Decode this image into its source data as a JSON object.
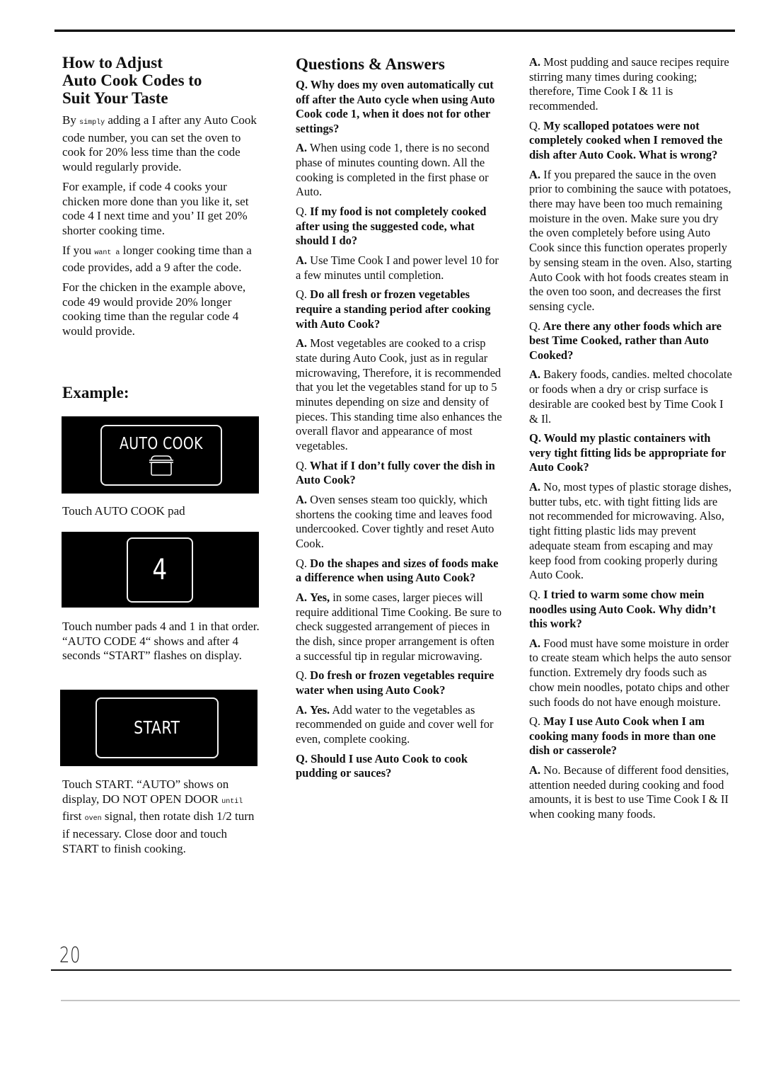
{
  "page_number": "20",
  "left": {
    "title_lines": [
      "How to Adjust",
      "Auto Cook Codes to",
      "Suit Your Taste"
    ],
    "paragraphs": [
      {
        "pre": "By",
        "mono": "simply",
        "post": "adding a I after any Auto Cook code number, you can set the oven to cook for 20% less time than the code would regularly provide."
      },
      {
        "text": "For example, if code 4 cooks your chicken more done than you like it, set code 4 I next time and you’ II get 20% shorter cooking time."
      },
      {
        "pre": "If you",
        "mono": "want a",
        "post": "longer cooking time than a code provides, add a 9 after the code."
      },
      {
        "text": "For the chicken in the example above, code 49 would provide 20% longer cooking time than the regular code 4 would provide."
      }
    ],
    "example_title": "Example:",
    "steps": [
      {
        "pad_label": "AUTO COOK",
        "pad_icon": "pot-icon",
        "caption": "Touch AUTO COOK pad"
      },
      {
        "pad_label": "4",
        "caption": "Touch number pads 4 and 1 in that order. “AUTO CODE 4“ shows and after 4 seconds “START” flashes on display."
      },
      {
        "pad_label": "START",
        "caption_parts": {
          "a": "Touch START. “AUTO” shows on display, DO NOT OPEN DOOR",
          "mono1": "until",
          "b": "first",
          "mono2": "oven",
          "c": "signal, then rotate dish 1/2 turn if necessary. Close door and touch START to finish cooking."
        }
      }
    ]
  },
  "qa": {
    "title": "Questions & Answers",
    "items": [
      {
        "q": "Why does my oven automatically cut off after the Auto cycle when using Auto Cook code 1, when it does not for other settings?",
        "q_prefix_bold": true,
        "a_lead": "",
        "a": "When using code 1, there is no second phase of minutes counting down. All the cooking is completed in the first phase or Auto."
      },
      {
        "q": "If my food is not completely cooked after using the suggested code, what should I do?",
        "q_prefix_bold": false,
        "a_lead": "",
        "a": "Use Time Cook I and power level 10 for a few minutes until completion."
      },
      {
        "q": "Do all fresh or frozen vegetables require a standing period after cooking with Auto Cook?",
        "q_prefix_bold": false,
        "a_lead": "",
        "a": "Most vegetables are cooked to a crisp state during Auto Cook, just as in regular microwaving, Therefore, it is recommended that you let the vegetables stand for up to 5 minutes depending on size and density of pieces. This standing time also enhances the overall flavor and appearance of most vegetables."
      },
      {
        "q": "What if I don’t fully cover the dish in Auto Cook?",
        "q_prefix_bold": false,
        "a_lead": "",
        "a": "Oven senses steam too quickly, which shortens the cooking time and leaves food undercooked. Cover tightly and reset Auto Cook."
      },
      {
        "q": "Do the shapes and sizes of foods make a difference when using Auto Cook?",
        "q_prefix_bold": false,
        "a_lead": "Yes,",
        "a": "in some cases, larger pieces will require additional Time Cooking. Be sure to check suggested arrangement of pieces in the dish, since proper arrangement is often a successful tip in regular microwaving."
      },
      {
        "q": "Do fresh or frozen vegetables require water when using Auto Cook?",
        "q_prefix_bold": false,
        "a_lead": "Yes.",
        "a": "Add water to the vegetables as recommended on guide and cover well for even, complete cooking."
      },
      {
        "q": "Should I use Auto Cook to cook pudding or sauces?",
        "q_prefix_bold": true,
        "a_lead": "",
        "a": "Most pudding and sauce recipes require stirring many times during cooking; therefore, Time Cook I & 11 is recommended."
      },
      {
        "q": "My scalloped potatoes were not completely cooked when I removed the dish after Auto Cook. What is wrong?",
        "q_prefix_bold": false,
        "a_lead": "",
        "a": "If you prepared the sauce in the oven prior to combining the sauce with potatoes, there may have been too much remaining moisture in the oven. Make sure you dry the oven completely before using Auto Cook since this function operates properly by sensing steam in the oven. Also, starting Auto Cook with hot foods creates steam in the oven too soon, and decreases the first sensing cycle."
      },
      {
        "q": "Are there any other foods which are best Time Cooked, rather than Auto Cooked?",
        "q_prefix_bold": false,
        "a_lead": "",
        "a": "Bakery foods, candies. melted chocolate or foods when a dry or crisp surface is desirable are cooked best by Time Cook I & Il."
      },
      {
        "q": "Would my plastic containers with very tight fitting lids be appropriate for Auto Cook?",
        "q_prefix_bold": true,
        "a_lead": "",
        "a": "No, most types of plastic storage dishes, butter tubs, etc. with tight fitting lids are not recommended for microwaving. Also, tight fitting plastic lids may prevent adequate steam from escaping and may keep food from cooking properly during Auto Cook."
      },
      {
        "q": "I tried to warm some chow mein noodles using Auto Cook. Why didn’t this work?",
        "q_prefix_bold": false,
        "a_lead": "",
        "a": "Food must have some moisture in order to create steam which helps the auto sensor function. Extremely dry foods such as chow mein noodles, potato chips and other such foods do not have enough moisture."
      },
      {
        "q": "May I use Auto Cook when I am cooking many foods in more than one dish or casserole?",
        "q_prefix_bold": false,
        "a_lead": "",
        "a": "No. Because of different food densities, attention needed during cooking and food amounts, it is best to use Time Cook I & II when cooking many foods."
      }
    ],
    "q_prefix": "Q.",
    "a_prefix": "A."
  }
}
